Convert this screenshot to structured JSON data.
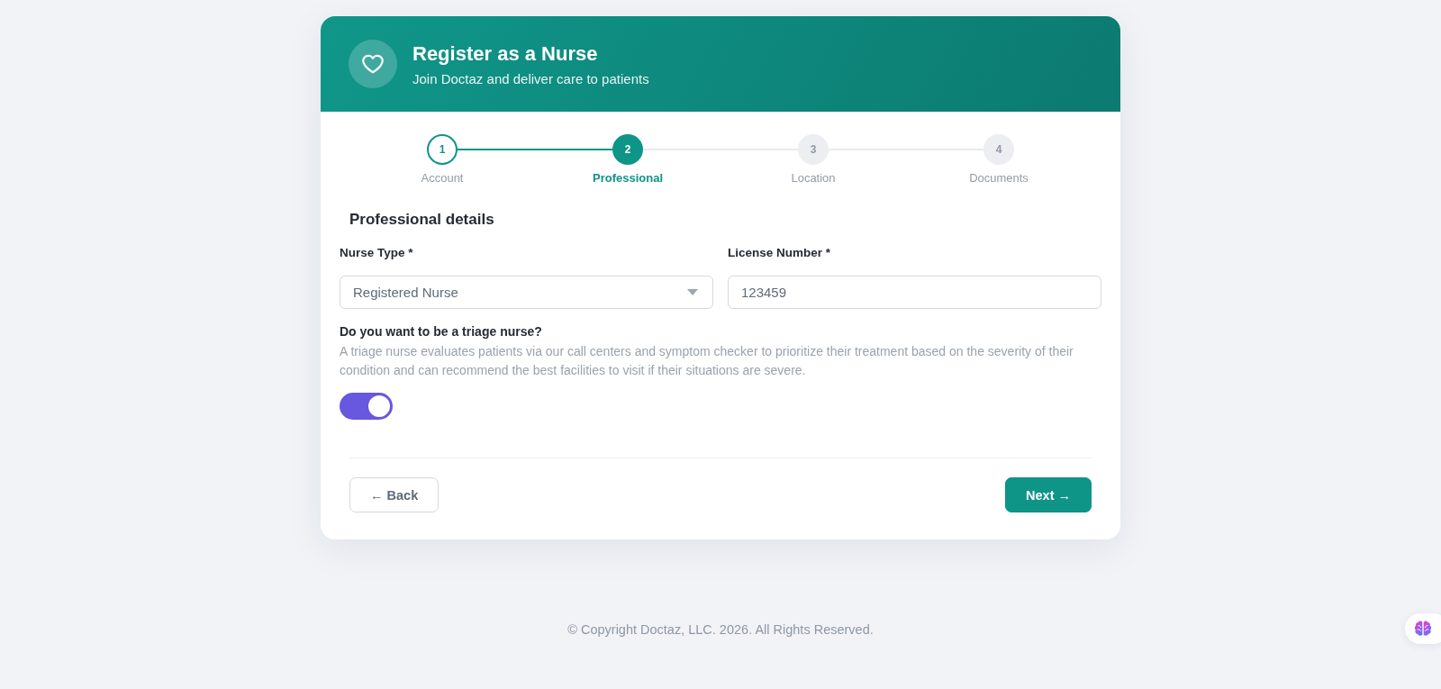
{
  "header": {
    "title": "Register as a Nurse",
    "subtitle": "Join Doctaz and deliver care to patients"
  },
  "stepper": {
    "steps": [
      {
        "number": "1",
        "label": "Account",
        "completed": true,
        "selected": false
      },
      {
        "number": "2",
        "label": "Professional",
        "completed": false,
        "selected": true
      },
      {
        "number": "3",
        "label": "Location",
        "completed": false,
        "selected": false
      },
      {
        "number": "4",
        "label": "Documents",
        "completed": false,
        "selected": false
      }
    ]
  },
  "section": {
    "title": "Professional details"
  },
  "fields": [
    {
      "kind": "select",
      "label": "Nurse Type *",
      "value": "Registered Nurse"
    },
    {
      "kind": "text",
      "label": "License Number *",
      "value": "123459"
    }
  ],
  "triage": {
    "question": "Do you want to be a triage nurse?",
    "description": "A triage nurse evaluates patients via our call centers and symptom checker to prioritize their treatment based on the severity of their condition and can recommend the best facilities to visit if their situations are severe.",
    "on": true
  },
  "buttons": [
    {
      "kind": "back",
      "label": "← Back"
    },
    {
      "kind": "next",
      "label": "Next →"
    }
  ],
  "footer": {
    "copyright": "© Copyright Doctaz, LLC. 2026. All Rights Reserved."
  }
}
